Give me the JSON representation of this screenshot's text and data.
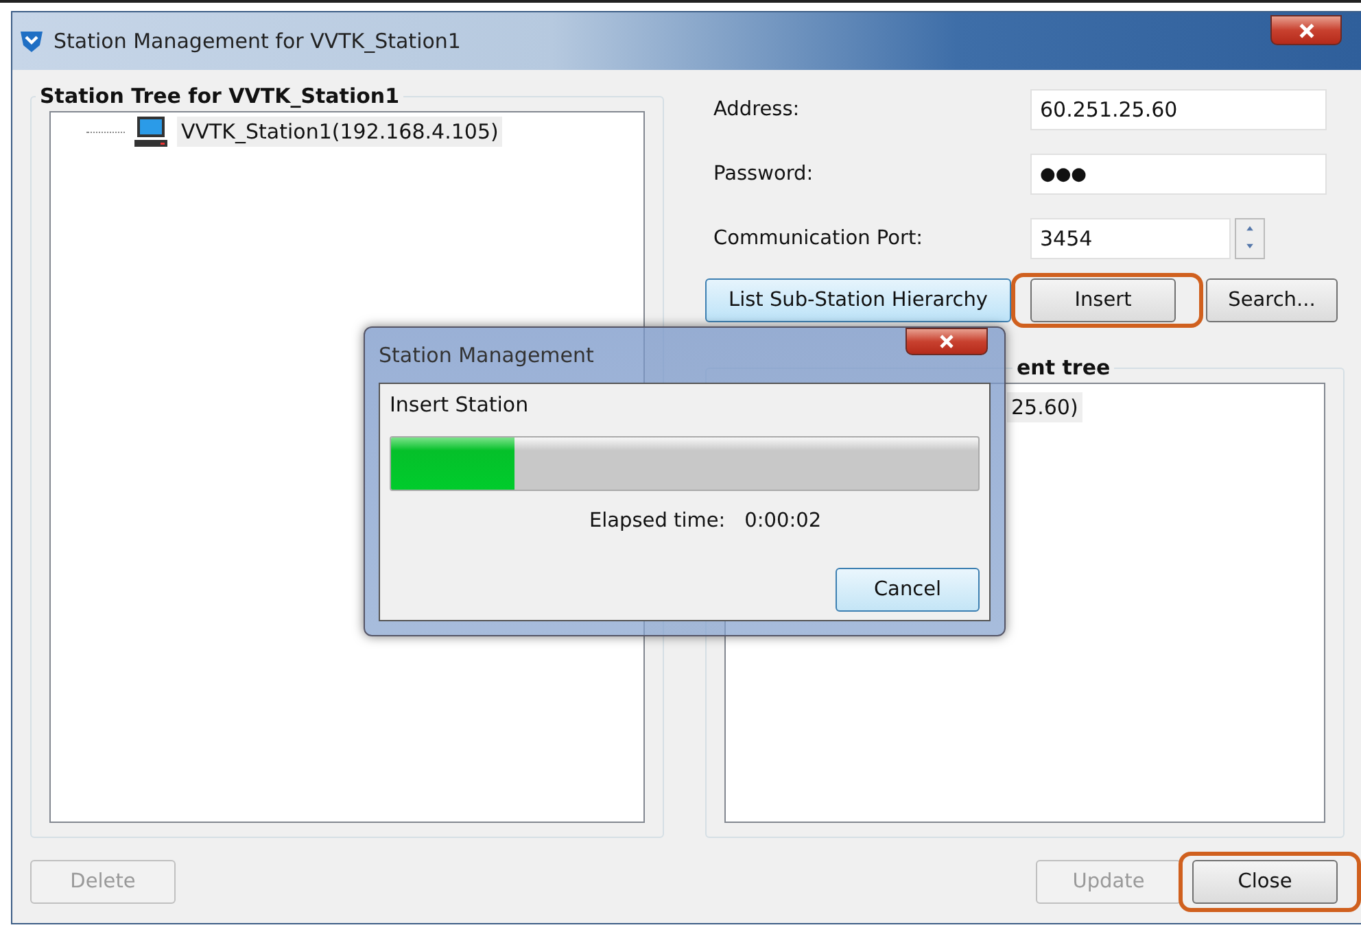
{
  "window": {
    "title": "Station Management for VVTK_Station1"
  },
  "station_tree": {
    "title": "Station Tree for VVTK_Station1",
    "items": [
      {
        "label": "VVTK_Station1(192.168.4.105)",
        "selected": true
      }
    ]
  },
  "form": {
    "address": {
      "label": "Address:",
      "value": "60.251.25.60"
    },
    "password": {
      "label": "Password:",
      "value": "●●●"
    },
    "port": {
      "label": "Communication Port:",
      "value": "3454"
    }
  },
  "actions": [
    {
      "label": "List Sub-Station Hierarchy",
      "focused": true,
      "highlighted": false
    },
    {
      "label": "Insert",
      "focused": false,
      "highlighted": true
    },
    {
      "label": "Search...",
      "focused": false,
      "highlighted": false
    }
  ],
  "hierarchy_tree": {
    "title": "ent tree",
    "items": [
      {
        "label": "25.60)",
        "selected": true
      }
    ]
  },
  "footer": {
    "delete": {
      "label": "Delete",
      "disabled": true
    },
    "update": {
      "label": "Update",
      "disabled": true
    },
    "close": {
      "label": "Close",
      "disabled": false,
      "highlighted": true
    }
  },
  "dialog": {
    "title": "Station Management",
    "message": "Insert Station",
    "level": 0.21,
    "elapsed_label": "Elapsed time:",
    "elapsed_value": "0:00:02",
    "cancel": "Cancel"
  }
}
